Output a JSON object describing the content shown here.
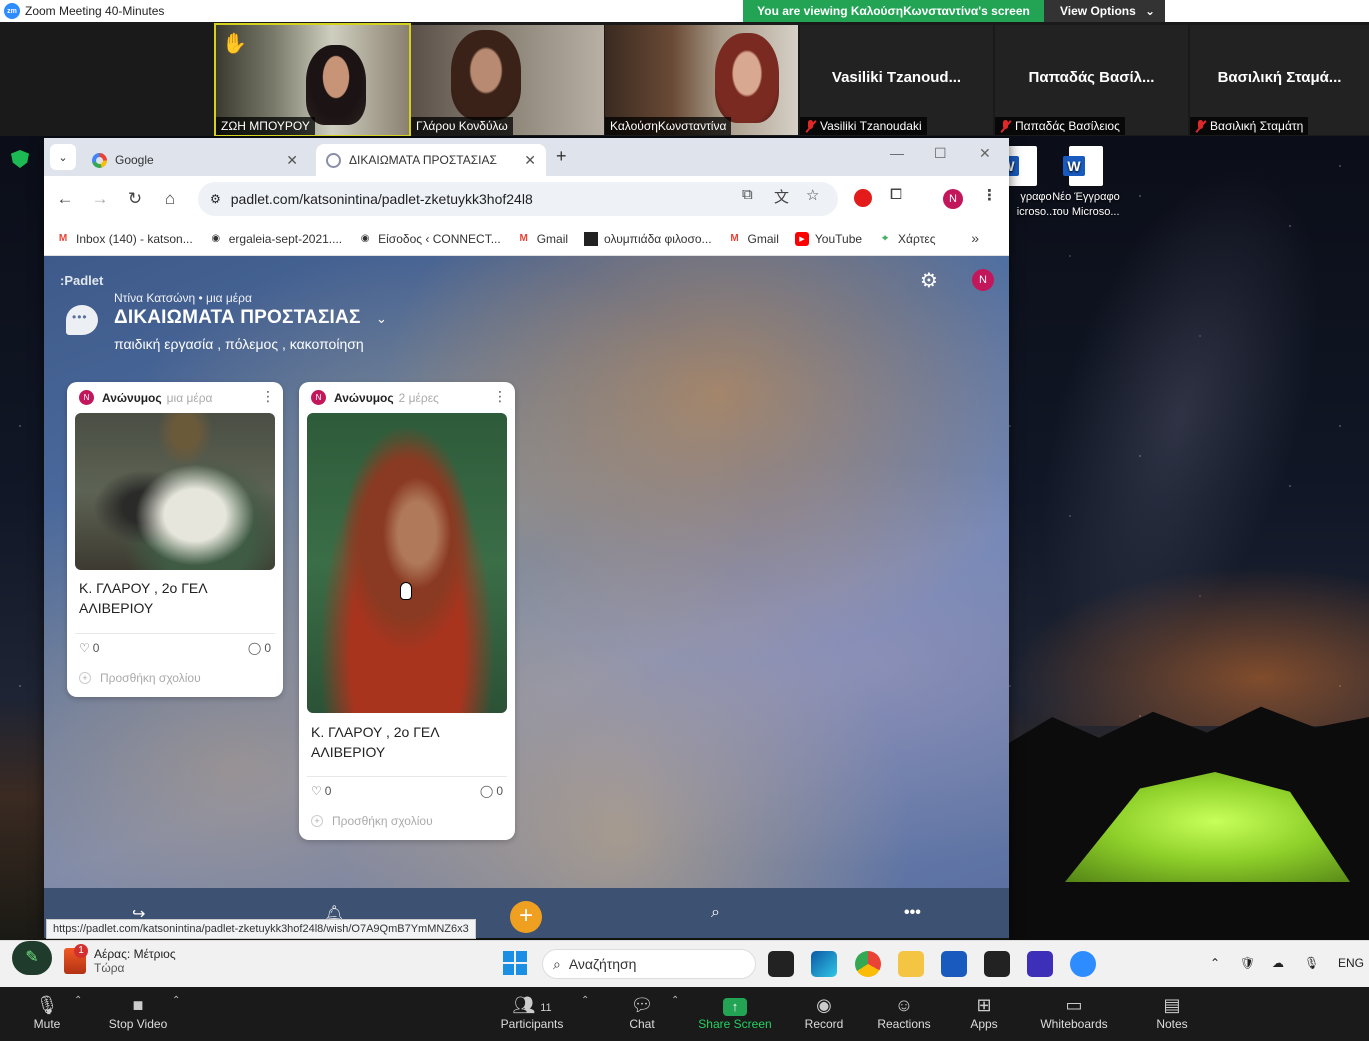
{
  "zoom": {
    "window_title": "Zoom Meeting 40-Minutes",
    "viewing_banner": "You are viewing ΚαλούσηΚωνσταντίνα's screen",
    "view_options": "View Options",
    "participants": [
      {
        "name": "ΖΩΗ ΜΠΟΥΡΟΥ",
        "hand_raised": true
      },
      {
        "name": "Γλάρου Κονδύλω"
      },
      {
        "name": "ΚαλούσηΚωνσταντίνα"
      },
      {
        "name": "Vasiliki Tzanoudaki",
        "display_name": "Vasiliki  Tzanoud...",
        "muted": true
      },
      {
        "name": "Παπαδάς Βασίλειος",
        "display_name": "Παπαδάς Βασίλ...",
        "muted": true
      },
      {
        "name": "Βασιλική Σταμάτη",
        "display_name": "Βασιλική Σταμά...",
        "muted": true
      }
    ],
    "controls": {
      "mute": "Mute",
      "stop_video": "Stop Video",
      "participants": "Participants",
      "participants_count": "11",
      "chat": "Chat",
      "share_screen": "Share Screen",
      "record": "Record",
      "reactions": "Reactions",
      "apps": "Apps",
      "whiteboards": "Whiteboards",
      "notes": "Notes"
    }
  },
  "desktop": {
    "icons": [
      {
        "label1": "γραφο",
        "label2": "icroso..."
      },
      {
        "label1": "Νέο Έγγραφο",
        "label2": "του Microso..."
      }
    ]
  },
  "browser": {
    "tabs": [
      {
        "title": "Google",
        "active": false
      },
      {
        "title": "ΔΙΚΑΙΩΜΑΤΑ ΠΡΟΣΤΑΣΙΑΣ",
        "active": true
      }
    ],
    "url": "padlet.com/katsonintina/padlet-zketuykk3hof24l8",
    "profile_initial": "N",
    "bookmarks": [
      {
        "label": "Inbox (140) - katson...",
        "icon": "gmail"
      },
      {
        "label": "ergaleia-sept-2021....",
        "icon": "globe"
      },
      {
        "label": "Είσοδος ‹ CONNECT...",
        "icon": "globe"
      },
      {
        "label": "Gmail",
        "icon": "gmail"
      },
      {
        "label": "ολυμπιάδα φιλοσο...",
        "icon": "image"
      },
      {
        "label": "Gmail",
        "icon": "gmail"
      },
      {
        "label": "YouTube",
        "icon": "youtube"
      },
      {
        "label": "Χάρτες",
        "icon": "maps"
      }
    ],
    "status_url": "https://padlet.com/katsonintina/padlet-zketuykk3hof24l8/wish/O7A9QmB7YmMNZ6x3"
  },
  "padlet": {
    "logo": ":Padlet",
    "author_line": "Ντίνα Κατσώνη • μια μέρα",
    "title": "ΔΙΚΑΙΩΜΑΤΑ ΠΡΟΣΤΑΣΙΑΣ",
    "subtitle": "παιδική εργασία , πόλεμος , κακοποίηση",
    "avatar_initial": "N",
    "posts": [
      {
        "author": "Ανώνυμος",
        "time": "μια μέρα",
        "line1": "Κ. ΓΛΑΡΟΥ , 2ο ΓΕΛ",
        "line2": "ΑΛΙΒΕΡΙΟΥ",
        "likes": "0",
        "comments": "0",
        "add_comment": "Προσθήκη σχολίου"
      },
      {
        "author": "Ανώνυμος",
        "time": "2 μέρες",
        "line1": "Κ. ΓΛΑΡΟΥ , 2ο ΓΕΛ",
        "line2": "ΑΛΙΒΕΡΙΟΥ",
        "likes": "0",
        "comments": "0",
        "add_comment": "Προσθήκη σχολίου"
      }
    ]
  },
  "taskbar": {
    "weather_title": "Αέρας: Μέτριος",
    "weather_sub": "Τώρα",
    "search_placeholder": "Αναζήτηση",
    "language": "ENG"
  }
}
